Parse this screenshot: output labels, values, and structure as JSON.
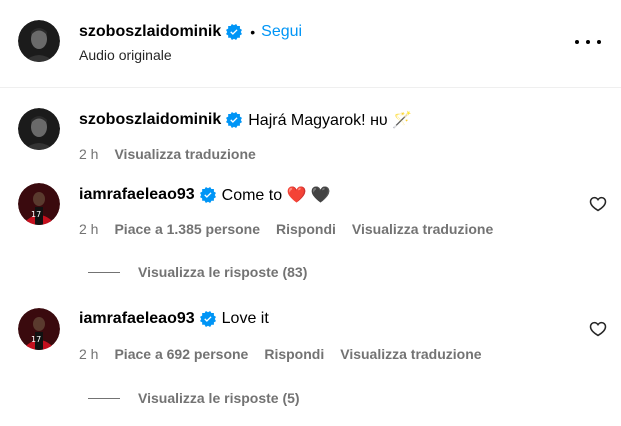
{
  "header": {
    "username": "szoboszlaidominik",
    "separator": "•",
    "follow_label": "Segui",
    "subtitle": "Audio originale",
    "more_icon": "more-horizontal-icon"
  },
  "comments": [
    {
      "username": "szoboszlaidominik",
      "text": "Hajrá Magyarok! ʜᴜ 🪄",
      "time": "2 h",
      "likes": "",
      "reply_label": "",
      "translate_label": "Visualizza traduzione",
      "replies_label": ""
    },
    {
      "username": "iamrafaeleao93",
      "text": "Come to ❤️ 🖤",
      "time": "2 h",
      "likes": "Piace a 1.385 persone",
      "reply_label": "Rispondi",
      "translate_label": "Visualizza traduzione",
      "replies_label": "Visualizza le risposte (83)"
    },
    {
      "username": "iamrafaeleao93",
      "text": "Love it",
      "time": "2 h",
      "likes": "Piace a 692 persone",
      "reply_label": "Rispondi",
      "translate_label": "Visualizza traduzione",
      "replies_label": "Visualizza le risposte (5)"
    }
  ],
  "colors": {
    "link": "#0095f6",
    "verified": "#0095f6",
    "secondary_text": "#737373"
  }
}
